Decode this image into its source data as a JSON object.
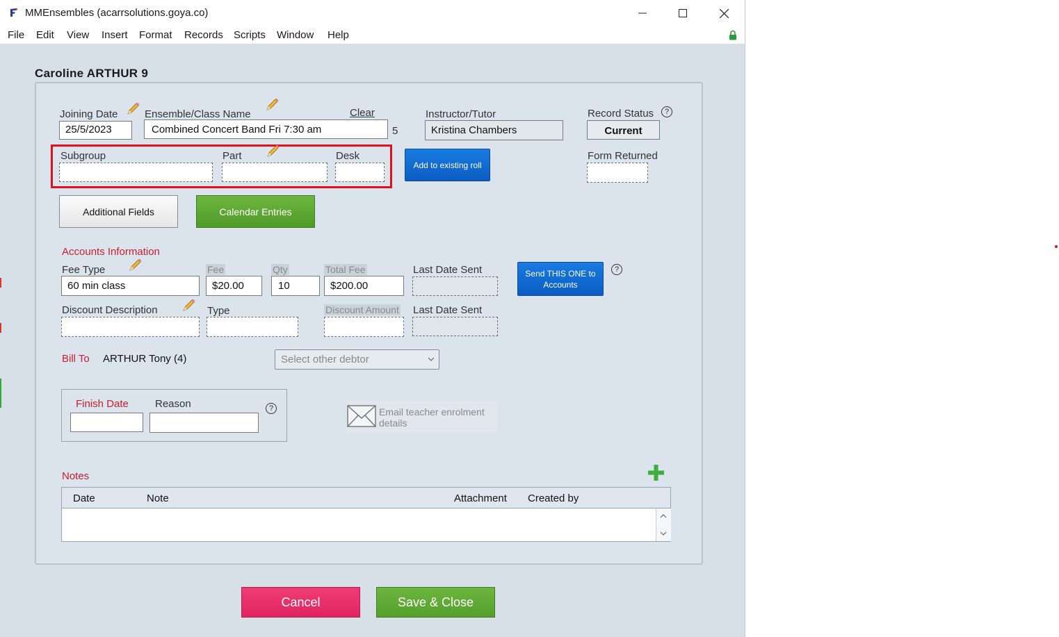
{
  "window": {
    "title": "MMEnsembles (acarrsolutions.goya.co)"
  },
  "menu": [
    "File",
    "Edit",
    "View",
    "Insert",
    "Format",
    "Records",
    "Scripts",
    "Window",
    "Help"
  ],
  "record": {
    "title": "Caroline ARTHUR 9"
  },
  "enrolment": {
    "joining_date_label": "Joining Date",
    "joining_date": "25/5/2023",
    "ensemble_label": "Ensemble/Class Name",
    "ensemble": "Combined Concert Band Fri 7:30 am",
    "ensemble_count": "5",
    "clear_label": "Clear",
    "instructor_label": "Instructor/Tutor",
    "instructor": "Kristina Chambers",
    "record_status_label": "Record Status",
    "record_status": "Current",
    "subgroup_label": "Subgroup",
    "part_label": "Part",
    "desk_label": "Desk",
    "add_roll_label": "Add to existing roll",
    "form_returned_label": "Form Returned",
    "additional_fields_label": "Additional Fields",
    "calendar_entries_label": "Calendar Entries"
  },
  "accounts": {
    "section_label": "Accounts Information",
    "fee_type_label": "Fee Type",
    "fee_type": "60 min class",
    "fee_label": "Fee",
    "fee": "$20.00",
    "qty_label": "Qty",
    "qty": "10",
    "total_fee_label": "Total Fee",
    "total_fee": "$200.00",
    "last_date_sent_label": "Last Date Sent",
    "send_button_label": "Send THIS ONE to Accounts",
    "discount_desc_label": "Discount Description",
    "type_label": "Type",
    "discount_amount_label": "Discount Amount",
    "last_date_sent_label_2": "Last Date Sent",
    "bill_to_label": "Bill To",
    "bill_to": "ARTHUR Tony (4)",
    "debtor_placeholder": "Select other debtor"
  },
  "finish": {
    "finish_date_label": "Finish Date",
    "reason_label": "Reason",
    "email_label": "Email teacher enrolment details"
  },
  "notes": {
    "section_label": "Notes",
    "columns": [
      "Date",
      "Note",
      "Attachment",
      "Created by"
    ]
  },
  "actions": {
    "cancel_label": "Cancel",
    "save_label": "Save & Close"
  },
  "colors": {
    "accent_red": "#c8202f",
    "highlight_red": "#e0101e",
    "button_blue": "#0a5cc2",
    "button_green": "#5ea832",
    "cancel_pink": "#ea2a66",
    "save_green": "#5ea832"
  }
}
